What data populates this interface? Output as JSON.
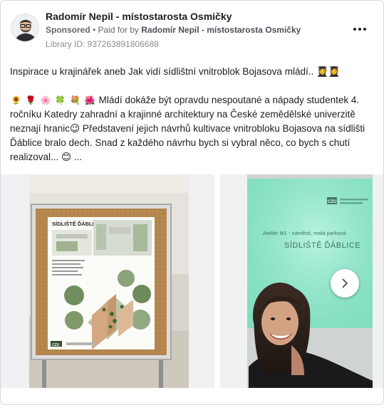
{
  "post": {
    "page_name": "Radomír Nepil - místostarosta Osmičky",
    "sponsored_label": "Sponsored",
    "paid_for_prefix": " • Paid for by ",
    "payer": "Radomír Nepil - místostarosta Osmičky",
    "library_id": "Library ID: 937263891806688",
    "title": "Inspirace u krajinářek aneb Jak vidí sídlištní vnitroblok Bojasova mládí.. 👩‍🎓👩‍🎓",
    "body_emojis": [
      "🌻",
      "🌹",
      "🌸",
      "🍀",
      "💐",
      "🌺"
    ],
    "body": "Mládí dokáže být opravdu nespoutané a nápady studentek 4. ročníku Katedry zahradní a krajinné architektury na České zemědělské univerzitě neznají hranic😉 Představení jejich návrhů kultivace vnitrobloku Bojasova na sídlišti Ďáblice bralo dech. Snad z každého návrhu bych si vybral něco, co bych s chutí realizoval... 😊 ..."
  },
  "carousel": {
    "slide1": {
      "poster_title": "SÍDLIŠTĚ ĎÁBLICE",
      "logo": "CZU"
    },
    "slide2": {
      "slide_logo": "CZU",
      "slide_subtitle": "Ateliér M1 - náměstí, malá parková",
      "slide_title": "SÍDLIŠTĚ ĎÁBLICE"
    },
    "next_icon": "chevron-right-icon"
  },
  "colors": {
    "name_text": "#1c1e21",
    "meta_text": "#65676b",
    "board_cork": "#b5874f",
    "projection": "#8fe3c8"
  }
}
